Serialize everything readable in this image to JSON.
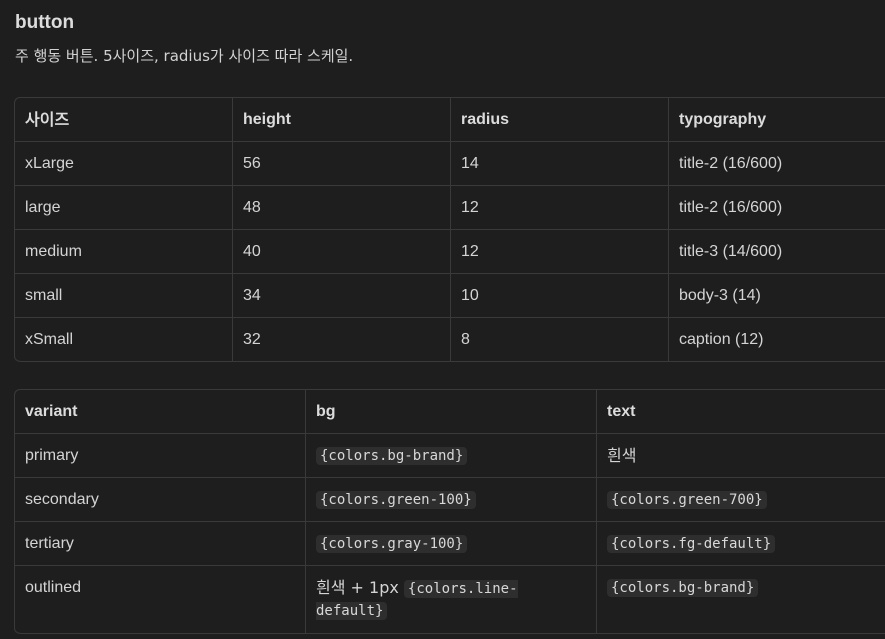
{
  "heading": {
    "title": "button",
    "description": "주 행동 버튼. 5사이즈, radius가 사이즈 따라 스케일."
  },
  "size_table": {
    "headers": [
      "사이즈",
      "height",
      "radius",
      "typography"
    ],
    "rows": [
      [
        "xLarge",
        "56",
        "14",
        "title-2 (16/600)"
      ],
      [
        "large",
        "48",
        "12",
        "title-2 (16/600)"
      ],
      [
        "medium",
        "40",
        "12",
        "title-3 (14/600)"
      ],
      [
        "small",
        "34",
        "10",
        "body-3 (14)"
      ],
      [
        "xSmall",
        "32",
        "8",
        "caption (12)"
      ]
    ]
  },
  "variant_table": {
    "headers": [
      "variant",
      "bg",
      "text"
    ],
    "rows": [
      {
        "variant": "primary",
        "bg_code": "{colors.bg-brand}",
        "text_plain": "흰색"
      },
      {
        "variant": "secondary",
        "bg_code": "{colors.green-100}",
        "text_code": "{colors.green-700}"
      },
      {
        "variant": "tertiary",
        "bg_code": "{colors.gray-100}",
        "text_code": "{colors.fg-default}"
      },
      {
        "variant": "outlined",
        "bg_prefix": "흰색 + 1px ",
        "bg_code": "{colors.line-default}",
        "text_code": "{colors.bg-brand}"
      }
    ]
  },
  "colors": {
    "background": "#1e1e1e",
    "border": "#3a3a3a",
    "text": "#d4d4d4",
    "code_bg": "#2e2e2e"
  }
}
